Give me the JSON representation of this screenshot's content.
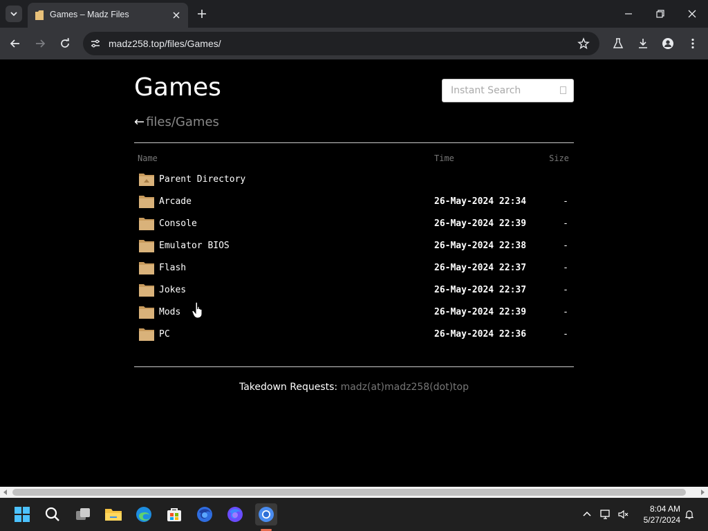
{
  "browser": {
    "tab_title": "Games – Madz Files",
    "url": "madz258.top/files/Games/"
  },
  "page": {
    "title": "Games",
    "breadcrumb_arrow": "←",
    "breadcrumb_path": "files/Games",
    "search_placeholder": "Instant Search",
    "columns": {
      "name": "Name",
      "time": "Time",
      "size": "Size"
    },
    "rows": [
      {
        "name": "Parent Directory",
        "time": "",
        "size": ""
      },
      {
        "name": "Arcade",
        "time": "26-May-2024 22:34",
        "size": "-"
      },
      {
        "name": "Console",
        "time": "26-May-2024 22:39",
        "size": "-"
      },
      {
        "name": "Emulator BIOS",
        "time": "26-May-2024 22:38",
        "size": "-"
      },
      {
        "name": "Flash",
        "time": "26-May-2024 22:37",
        "size": "-"
      },
      {
        "name": "Jokes",
        "time": "26-May-2024 22:37",
        "size": "-"
      },
      {
        "name": "Mods",
        "time": "26-May-2024 22:39",
        "size": "-"
      },
      {
        "name": "PC",
        "time": "26-May-2024 22:36",
        "size": "-"
      }
    ],
    "footer_label": "Takedown Requests:",
    "footer_email": "madz(at)madz258(dot)top"
  },
  "taskbar": {
    "time": "8:04 AM",
    "date": "5/27/2024",
    "apps": [
      "start-icon",
      "search-icon",
      "task-view-icon",
      "file-explorer-icon",
      "edge-icon",
      "store-icon",
      "firefox-icon",
      "firefox-dev-icon",
      "chrome-icon"
    ]
  },
  "colors": {
    "page_bg": "#000000",
    "chrome_bg": "#35363a",
    "folder": "#d9b27a",
    "active_app": "#e86b4e"
  }
}
